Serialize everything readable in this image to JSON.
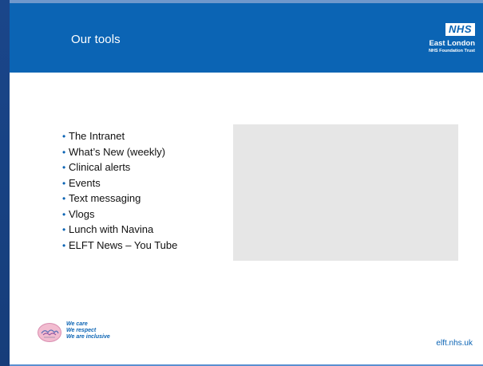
{
  "slide": {
    "title": "Our tools",
    "brand": {
      "badge": "NHS",
      "org_name": "East London",
      "org_sub": "NHS Foundation Trust"
    },
    "tools": [
      "The Intranet",
      "What’s New (weekly)",
      "Clinical alerts",
      "Events",
      "Text messaging",
      "Vlogs",
      "Lunch with Navina",
      "ELFT News – You Tube"
    ],
    "values": {
      "line1": "We care",
      "line2": "We respect",
      "line3": "We are inclusive"
    },
    "url": "elft.nhs.uk"
  },
  "colors": {
    "header_blue": "#0b64b4",
    "bullet_blue": "#0b64b4",
    "placeholder_gray": "#e6e6e6"
  }
}
